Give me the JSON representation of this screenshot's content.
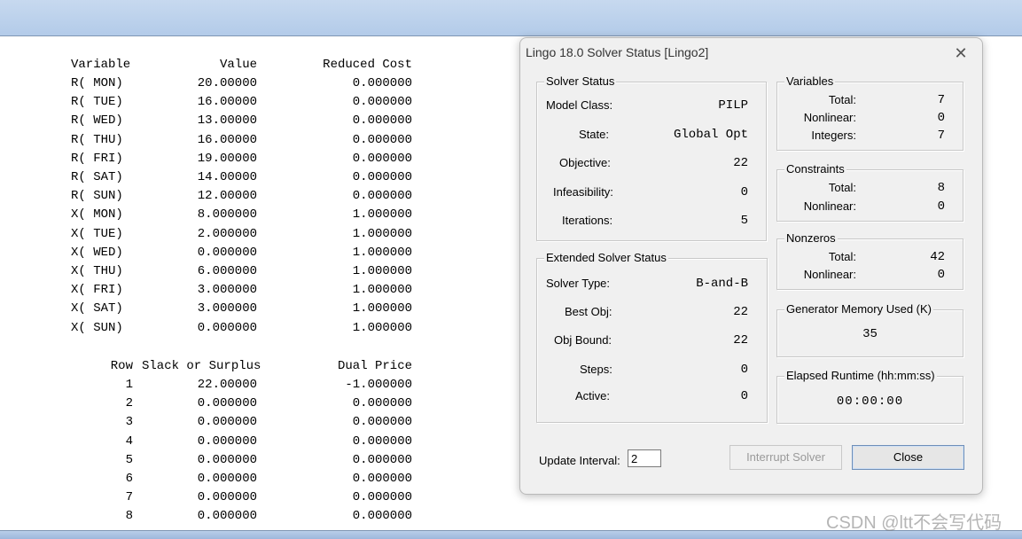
{
  "report": {
    "var_header": {
      "variable": "Variable",
      "value": "Value",
      "reduced_cost": "Reduced Cost"
    },
    "variables": [
      {
        "name": "R( MON)",
        "value": "20.00000",
        "reduced_cost": "0.000000"
      },
      {
        "name": "R( TUE)",
        "value": "16.00000",
        "reduced_cost": "0.000000"
      },
      {
        "name": "R( WED)",
        "value": "13.00000",
        "reduced_cost": "0.000000"
      },
      {
        "name": "R( THU)",
        "value": "16.00000",
        "reduced_cost": "0.000000"
      },
      {
        "name": "R( FRI)",
        "value": "19.00000",
        "reduced_cost": "0.000000"
      },
      {
        "name": "R( SAT)",
        "value": "14.00000",
        "reduced_cost": "0.000000"
      },
      {
        "name": "R( SUN)",
        "value": "12.00000",
        "reduced_cost": "0.000000"
      },
      {
        "name": "X( MON)",
        "value": "8.000000",
        "reduced_cost": "1.000000"
      },
      {
        "name": "X( TUE)",
        "value": "2.000000",
        "reduced_cost": "1.000000"
      },
      {
        "name": "X( WED)",
        "value": "0.000000",
        "reduced_cost": "1.000000"
      },
      {
        "name": "X( THU)",
        "value": "6.000000",
        "reduced_cost": "1.000000"
      },
      {
        "name": "X( FRI)",
        "value": "3.000000",
        "reduced_cost": "1.000000"
      },
      {
        "name": "X( SAT)",
        "value": "3.000000",
        "reduced_cost": "1.000000"
      },
      {
        "name": "X( SUN)",
        "value": "0.000000",
        "reduced_cost": "1.000000"
      }
    ],
    "row_header": {
      "row": "Row",
      "slack": "Slack or Surplus",
      "dual": "Dual Price"
    },
    "rows": [
      {
        "row": "1",
        "slack": "22.00000",
        "dual": "-1.000000"
      },
      {
        "row": "2",
        "slack": "0.000000",
        "dual": "0.000000"
      },
      {
        "row": "3",
        "slack": "0.000000",
        "dual": "0.000000"
      },
      {
        "row": "4",
        "slack": "0.000000",
        "dual": "0.000000"
      },
      {
        "row": "5",
        "slack": "0.000000",
        "dual": "0.000000"
      },
      {
        "row": "6",
        "slack": "0.000000",
        "dual": "0.000000"
      },
      {
        "row": "7",
        "slack": "0.000000",
        "dual": "0.000000"
      },
      {
        "row": "8",
        "slack": "0.000000",
        "dual": "0.000000"
      }
    ]
  },
  "dialog": {
    "title": "Lingo 18.0 Solver Status [Lingo2]",
    "close_glyph": "✕",
    "solver_status": {
      "legend": "Solver Status",
      "model_class_label": "Model Class:",
      "model_class": "PILP",
      "state_label": "State:",
      "state": "Global Opt",
      "objective_label": "Objective:",
      "objective": "22",
      "infeasibility_label": "Infeasibility:",
      "infeasibility": "0",
      "iterations_label": "Iterations:",
      "iterations": "5"
    },
    "extended": {
      "legend": "Extended Solver Status",
      "solver_type_label": "Solver Type:",
      "solver_type": "B-and-B",
      "best_obj_label": "Best Obj:",
      "best_obj": "22",
      "obj_bound_label": "Obj Bound:",
      "obj_bound": "22",
      "steps_label": "Steps:",
      "steps": "0",
      "active_label": "Active:",
      "active": "0"
    },
    "variables": {
      "legend": "Variables",
      "total_label": "Total:",
      "total": "7",
      "nonlinear_label": "Nonlinear:",
      "nonlinear": "0",
      "integers_label": "Integers:",
      "integers": "7"
    },
    "constraints": {
      "legend": "Constraints",
      "total_label": "Total:",
      "total": "8",
      "nonlinear_label": "Nonlinear:",
      "nonlinear": "0"
    },
    "nonzeros": {
      "legend": "Nonzeros",
      "total_label": "Total:",
      "total": "42",
      "nonlinear_label": "Nonlinear:",
      "nonlinear": "0"
    },
    "memory": {
      "legend": "Generator Memory Used (K)",
      "value": "35"
    },
    "runtime": {
      "legend": "Elapsed Runtime (hh:mm:ss)",
      "value": "00:00:00"
    },
    "update_interval_label": "Update Interval:",
    "update_interval": "2",
    "interrupt_label": "Interrupt Solver",
    "close_label": "Close"
  },
  "watermark": "CSDN @ltt不会写代码"
}
